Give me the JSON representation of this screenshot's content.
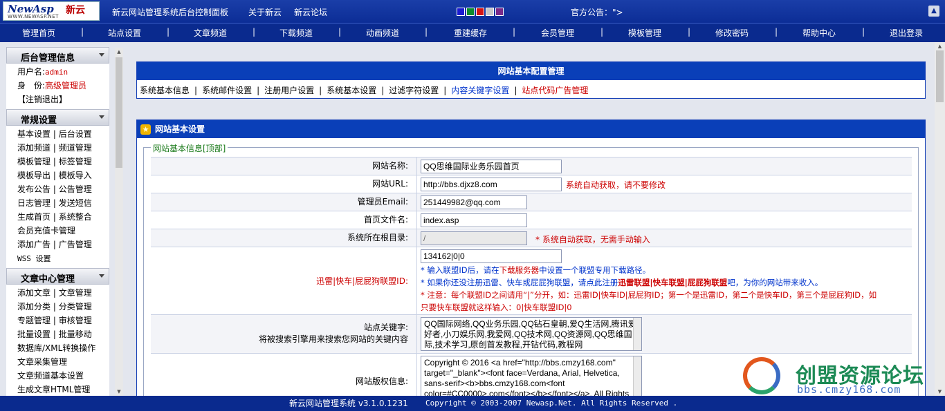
{
  "header": {
    "logo_text": "NewAsp",
    "logo_cn": "新云",
    "logo_url": "WWW.NEWASP.NET",
    "title": "新云网站管理系统后台控制面板",
    "about": "关于新云",
    "forum": "新云论坛",
    "notice": "官方公告：\">",
    "swatches": [
      "#1a1ad0",
      "#0c8c2c",
      "#d41414",
      "#c8c8c8",
      "#7a2a8a"
    ]
  },
  "nav": [
    "管理首页",
    "站点设置",
    "文章频道",
    "下载频道",
    "动画频道",
    "重建缓存",
    "会员管理",
    "模板管理",
    "修改密码",
    "帮助中心",
    "退出登录"
  ],
  "sidebar": {
    "admin_info": {
      "title": "后台管理信息",
      "user_label": "用户名:",
      "user_value": "admin",
      "role_label": "身　份:",
      "role_value": "高级管理员",
      "logout": "【注销退出】"
    },
    "common": {
      "title": "常规设置",
      "rows": [
        [
          "基本设置",
          "后台设置"
        ],
        [
          "添加频道",
          "频道管理"
        ],
        [
          "模板管理",
          "标签管理"
        ],
        [
          "模板导出",
          "模板导入"
        ],
        [
          "发布公告",
          "公告管理"
        ],
        [
          "日志管理",
          "发送短信"
        ],
        [
          "生成首页",
          "系统整合"
        ],
        [
          "会员充值卡管理"
        ],
        [
          "添加广告",
          "广告管理"
        ],
        [
          "WSS 设置"
        ]
      ]
    },
    "article": {
      "title": "文章中心管理",
      "rows": [
        [
          "添加文章",
          "文章管理"
        ],
        [
          "添加分类",
          "分类管理"
        ],
        [
          "专题管理",
          "审核管理"
        ],
        [
          "批量设置",
          "批量移动"
        ],
        [
          "数据库/XML转换操作"
        ],
        [
          "文章采集管理"
        ],
        [
          "文章频道基本设置"
        ],
        [
          "生成文章HTML管理"
        ]
      ]
    }
  },
  "config_panel": {
    "title": "网站基本配置管理",
    "tabs": [
      "系统基本信息",
      "系统邮件设置",
      "注册用户设置",
      "系统基本设置",
      "过滤字符设置",
      "内容关键字设置",
      "站点代码广告管理"
    ]
  },
  "settings_panel": {
    "title": "网站基本设置",
    "legend": "网站基本信息[顶部]",
    "site_name_label": "网站名称:",
    "site_name": "QQ思维国际业务乐园首页",
    "site_url_label": "网站URL:",
    "site_url": "http://bbs.djxz8.com",
    "site_url_note": "系统自动获取，请不要修改",
    "email_label": "管理员Email:",
    "email": "251449982@qq.com",
    "index_label": "首页文件名:",
    "index_file": "index.asp",
    "root_label": "系统所在根目录:",
    "root_dir": "/",
    "root_note": "* 系统自动获取，无需手动输入",
    "union_label": "迅雷|快车|屁屁狗联盟ID:",
    "union_value": "134162|0|0",
    "union_note1_a": "* 输入联盟ID后，请在",
    "union_note1_b": "下载服务器",
    "union_note1_c": "中设置一个联盟专用下载路径。",
    "union_note2_a": "* 如果你还没注册迅雷、快车或屁屁狗联盟，请点此注册",
    "union_note2_b": "迅雷联盟",
    "union_note2_c": "|",
    "union_note2_d": "快车联盟",
    "union_note2_e": "|",
    "union_note2_f": "屁屁狗联盟",
    "union_note2_g": "吧，为你的网站带来收入。",
    "union_note3": "* 注意：每个联盟ID之间请用“|”分开，如：迅雷ID|快车ID|屁屁狗ID；第一个是迅雷ID，第二个是快车ID，第三个是屁屁狗ID，如",
    "union_note4": "只要快车联盟就这样输入：0|快车联盟ID|0",
    "keywords_label": "站点关键字:",
    "keywords_hint": "将被搜索引擎用来搜索您网站的关键内容",
    "keywords_value": "QQ国际网络,QQ业务乐园,QQ钻石皇朝,爱Q生活网,腾讯爱好者,小刀娱乐网,我爱网,QQ技术网,QQ资源网,QQ思维国际,技术学习,原创首发教程,开钻代码,教程网",
    "copyright_label": "网站版权信息:",
    "copyright_value": "Copyright © 2016 <a href=\"http://bbs.cmzy168.com\" target=\"_blank\"><font face=Verdana, Arial, Helvetica, sans-serif><b>bbs.cmzy168.com<font color=#CC0000>.com</font></b></font></a>. All Rights"
  },
  "footer": {
    "product": "新云网站管理系统 v3.1.0.1231",
    "copyright": "Copyright © 2003-2007 Newasp.Net. All Rights Reserved ."
  },
  "watermark": {
    "title": "创盟资源论坛",
    "url": "bbs.cmzy168.com"
  }
}
